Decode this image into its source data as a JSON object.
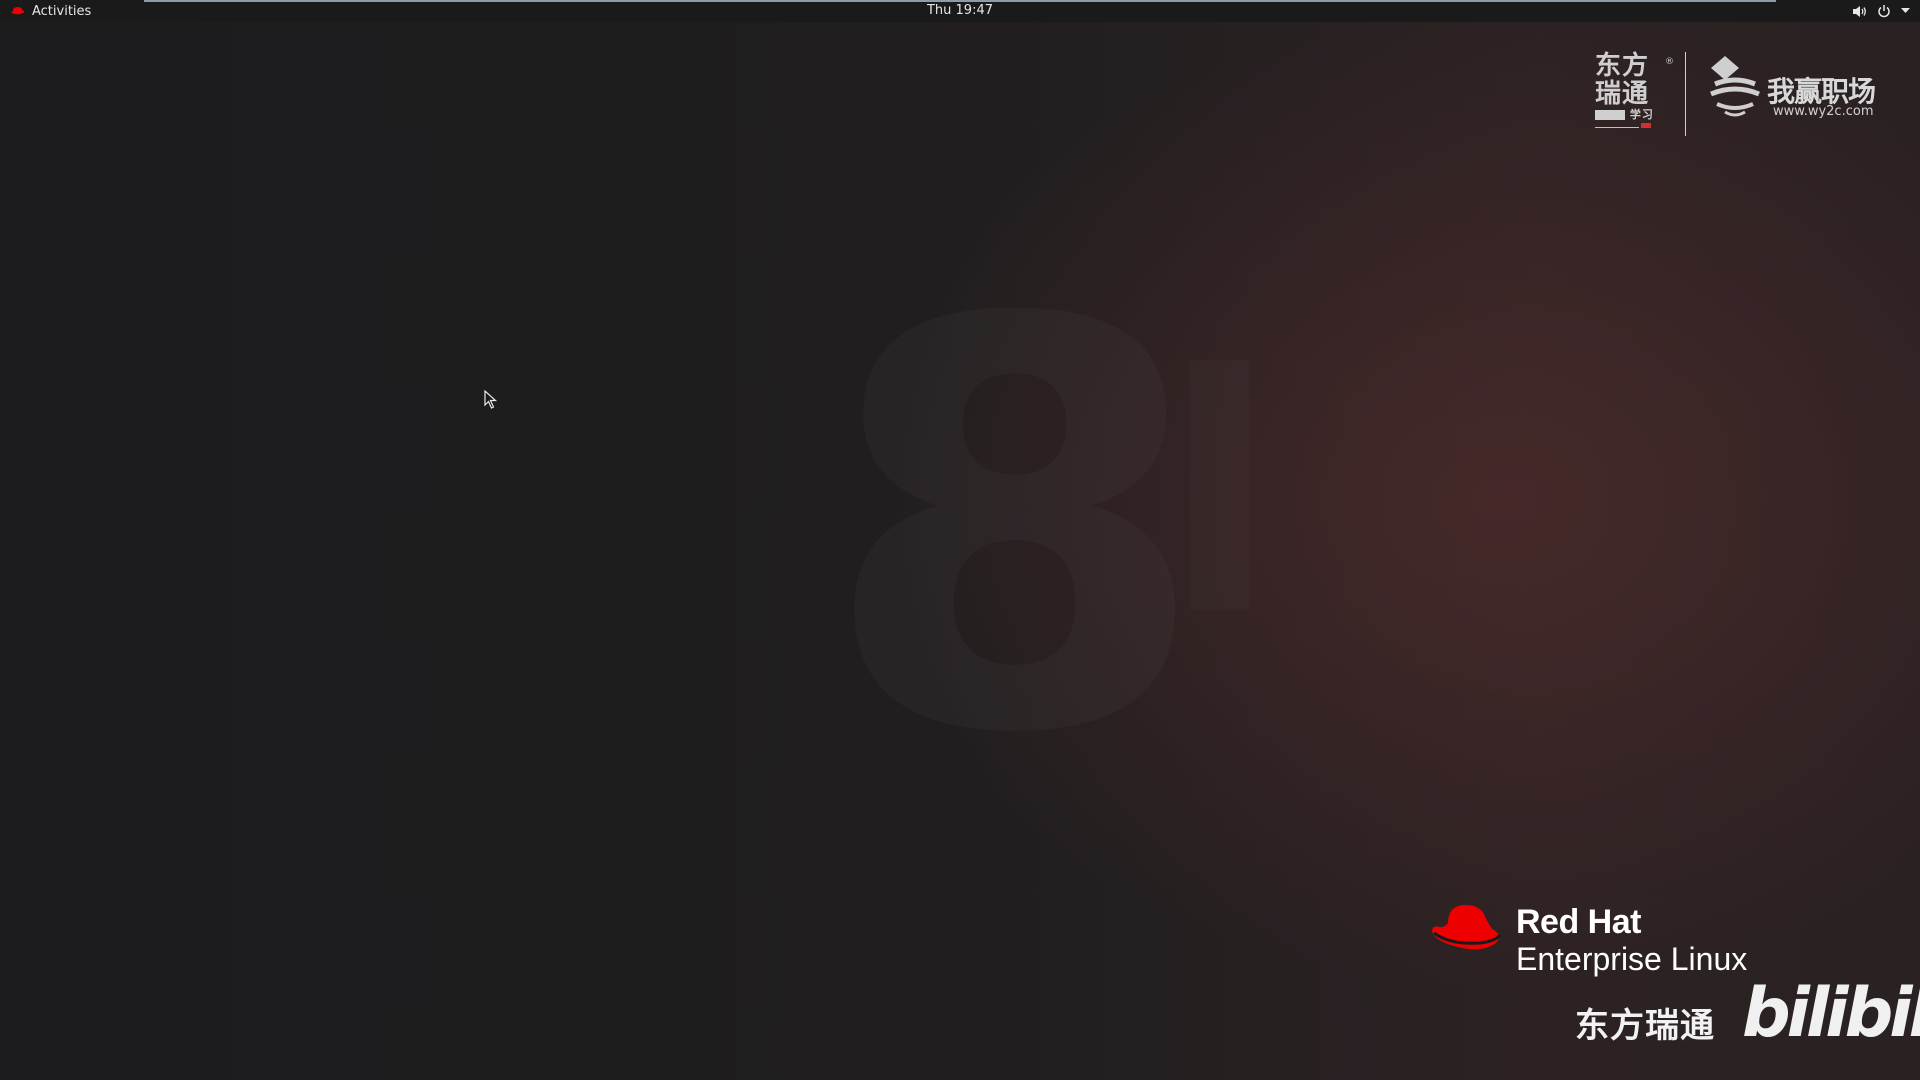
{
  "topbar": {
    "activities_label": "Activities",
    "clock": "Thu 19:47",
    "tray_icons": [
      "volume-icon",
      "power-icon",
      "chevron-down-icon"
    ]
  },
  "wallpaper": {
    "version_mark": "8"
  },
  "logos": {
    "partner_left": {
      "line1": "东方",
      "line2": "瑞通",
      "line3": "学习",
      "registered": "®"
    },
    "partner_right": {
      "brand": "我赢职场",
      "url": "www.wy2c.com"
    }
  },
  "branding": {
    "line1": "Red Hat",
    "line2": "Enterprise Linux",
    "cn_name": "东方瑞通",
    "video_site": "bilibili"
  },
  "colors": {
    "topbar_bg": "#1a1a1a",
    "desktop_bg": "#1c1c1e",
    "redhat_red": "#ee0000",
    "text_light": "#e6e6e6"
  }
}
